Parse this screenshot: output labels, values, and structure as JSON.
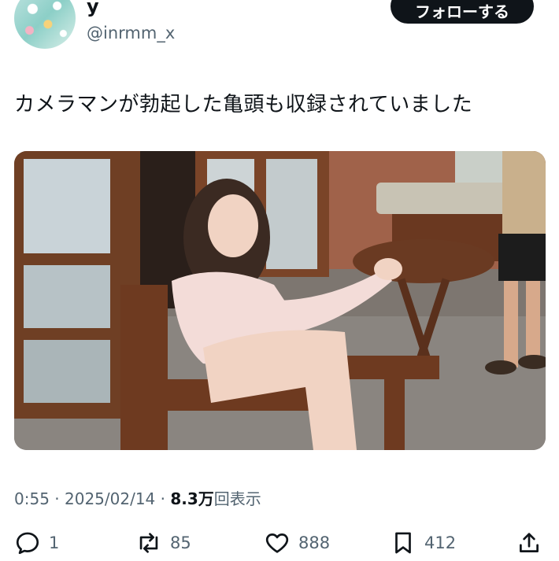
{
  "user": {
    "display_name": "y",
    "handle": "@inrmm_x",
    "follow_label": "フォローする"
  },
  "tweet": {
    "text": "カメラマンが勃起した亀頭も収録されていました",
    "time": "0:55",
    "date": "2025/02/14",
    "views_count": "8.3万",
    "views_label": "回表示"
  },
  "actions": {
    "replies": "1",
    "retweets": "85",
    "likes": "888",
    "bookmarks": "412"
  },
  "icons": [
    "reply-icon",
    "retweet-icon",
    "like-icon",
    "bookmark-icon",
    "share-icon"
  ],
  "colors": {
    "text": "#0f1419",
    "secondary": "#536471",
    "follow_bg": "#0f1419"
  }
}
